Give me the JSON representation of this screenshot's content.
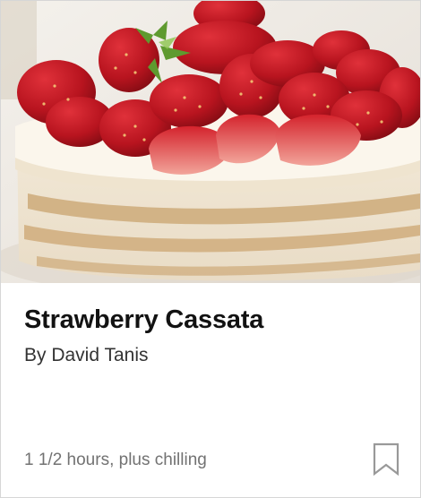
{
  "recipe": {
    "title": "Strawberry Cassata",
    "byline": "By David Tanis",
    "time": "1 1/2 hours, plus chilling",
    "image_icon": "strawberry-cassata-photo",
    "save_icon": "bookmark-icon"
  },
  "colors": {
    "title": "#121212",
    "byline": "#333333",
    "meta": "#727272",
    "icon": "#999999",
    "border": "#d6d6d6"
  }
}
